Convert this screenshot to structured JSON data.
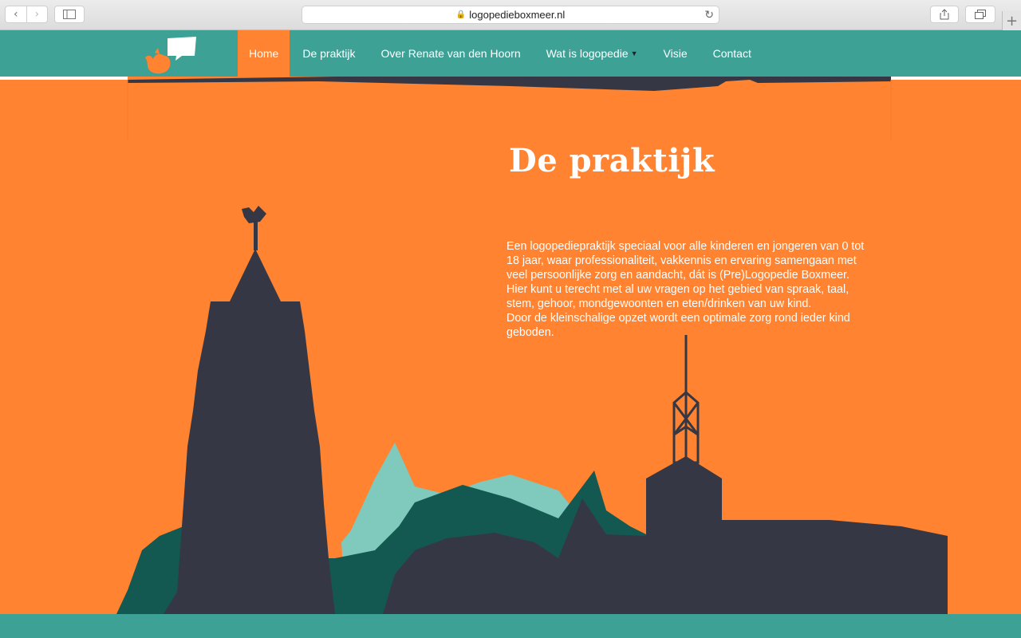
{
  "browser": {
    "url": "logopedieboxmeer.nl",
    "back_icon": "‹",
    "forward_icon": "›",
    "new_tab_label": "+"
  },
  "nav": {
    "items": [
      {
        "label": "Home"
      },
      {
        "label": "De praktijk"
      },
      {
        "label": "Over Renate van den Hoorn"
      },
      {
        "label": "Wat is logopedie"
      },
      {
        "label": "Visie"
      },
      {
        "label": "Contact"
      }
    ]
  },
  "main": {
    "title": "De praktijk",
    "paragraphs": [
      "Een logopediepraktijk speciaal voor alle kinderen en jongeren van 0 tot 18 jaar, waar professionaliteit, vakkennis en ervaring samengaan met veel persoonlijke zorg en aandacht, dát is (Pre)Logopedie Boxmeer.",
      "Hier kunt u terecht met al uw vragen op het gebied van spraak, taal, stem, gehoor, mondgewoonten en eten/drinken van uw kind.",
      "Door de kleinschalige opzet wordt een optimale zorg rond ieder kind geboden."
    ]
  },
  "colors": {
    "teal": "#3da196",
    "orange": "#ff8330",
    "dark": "#353844",
    "dark_teal": "#135952",
    "light_teal": "#7fc9bd"
  }
}
